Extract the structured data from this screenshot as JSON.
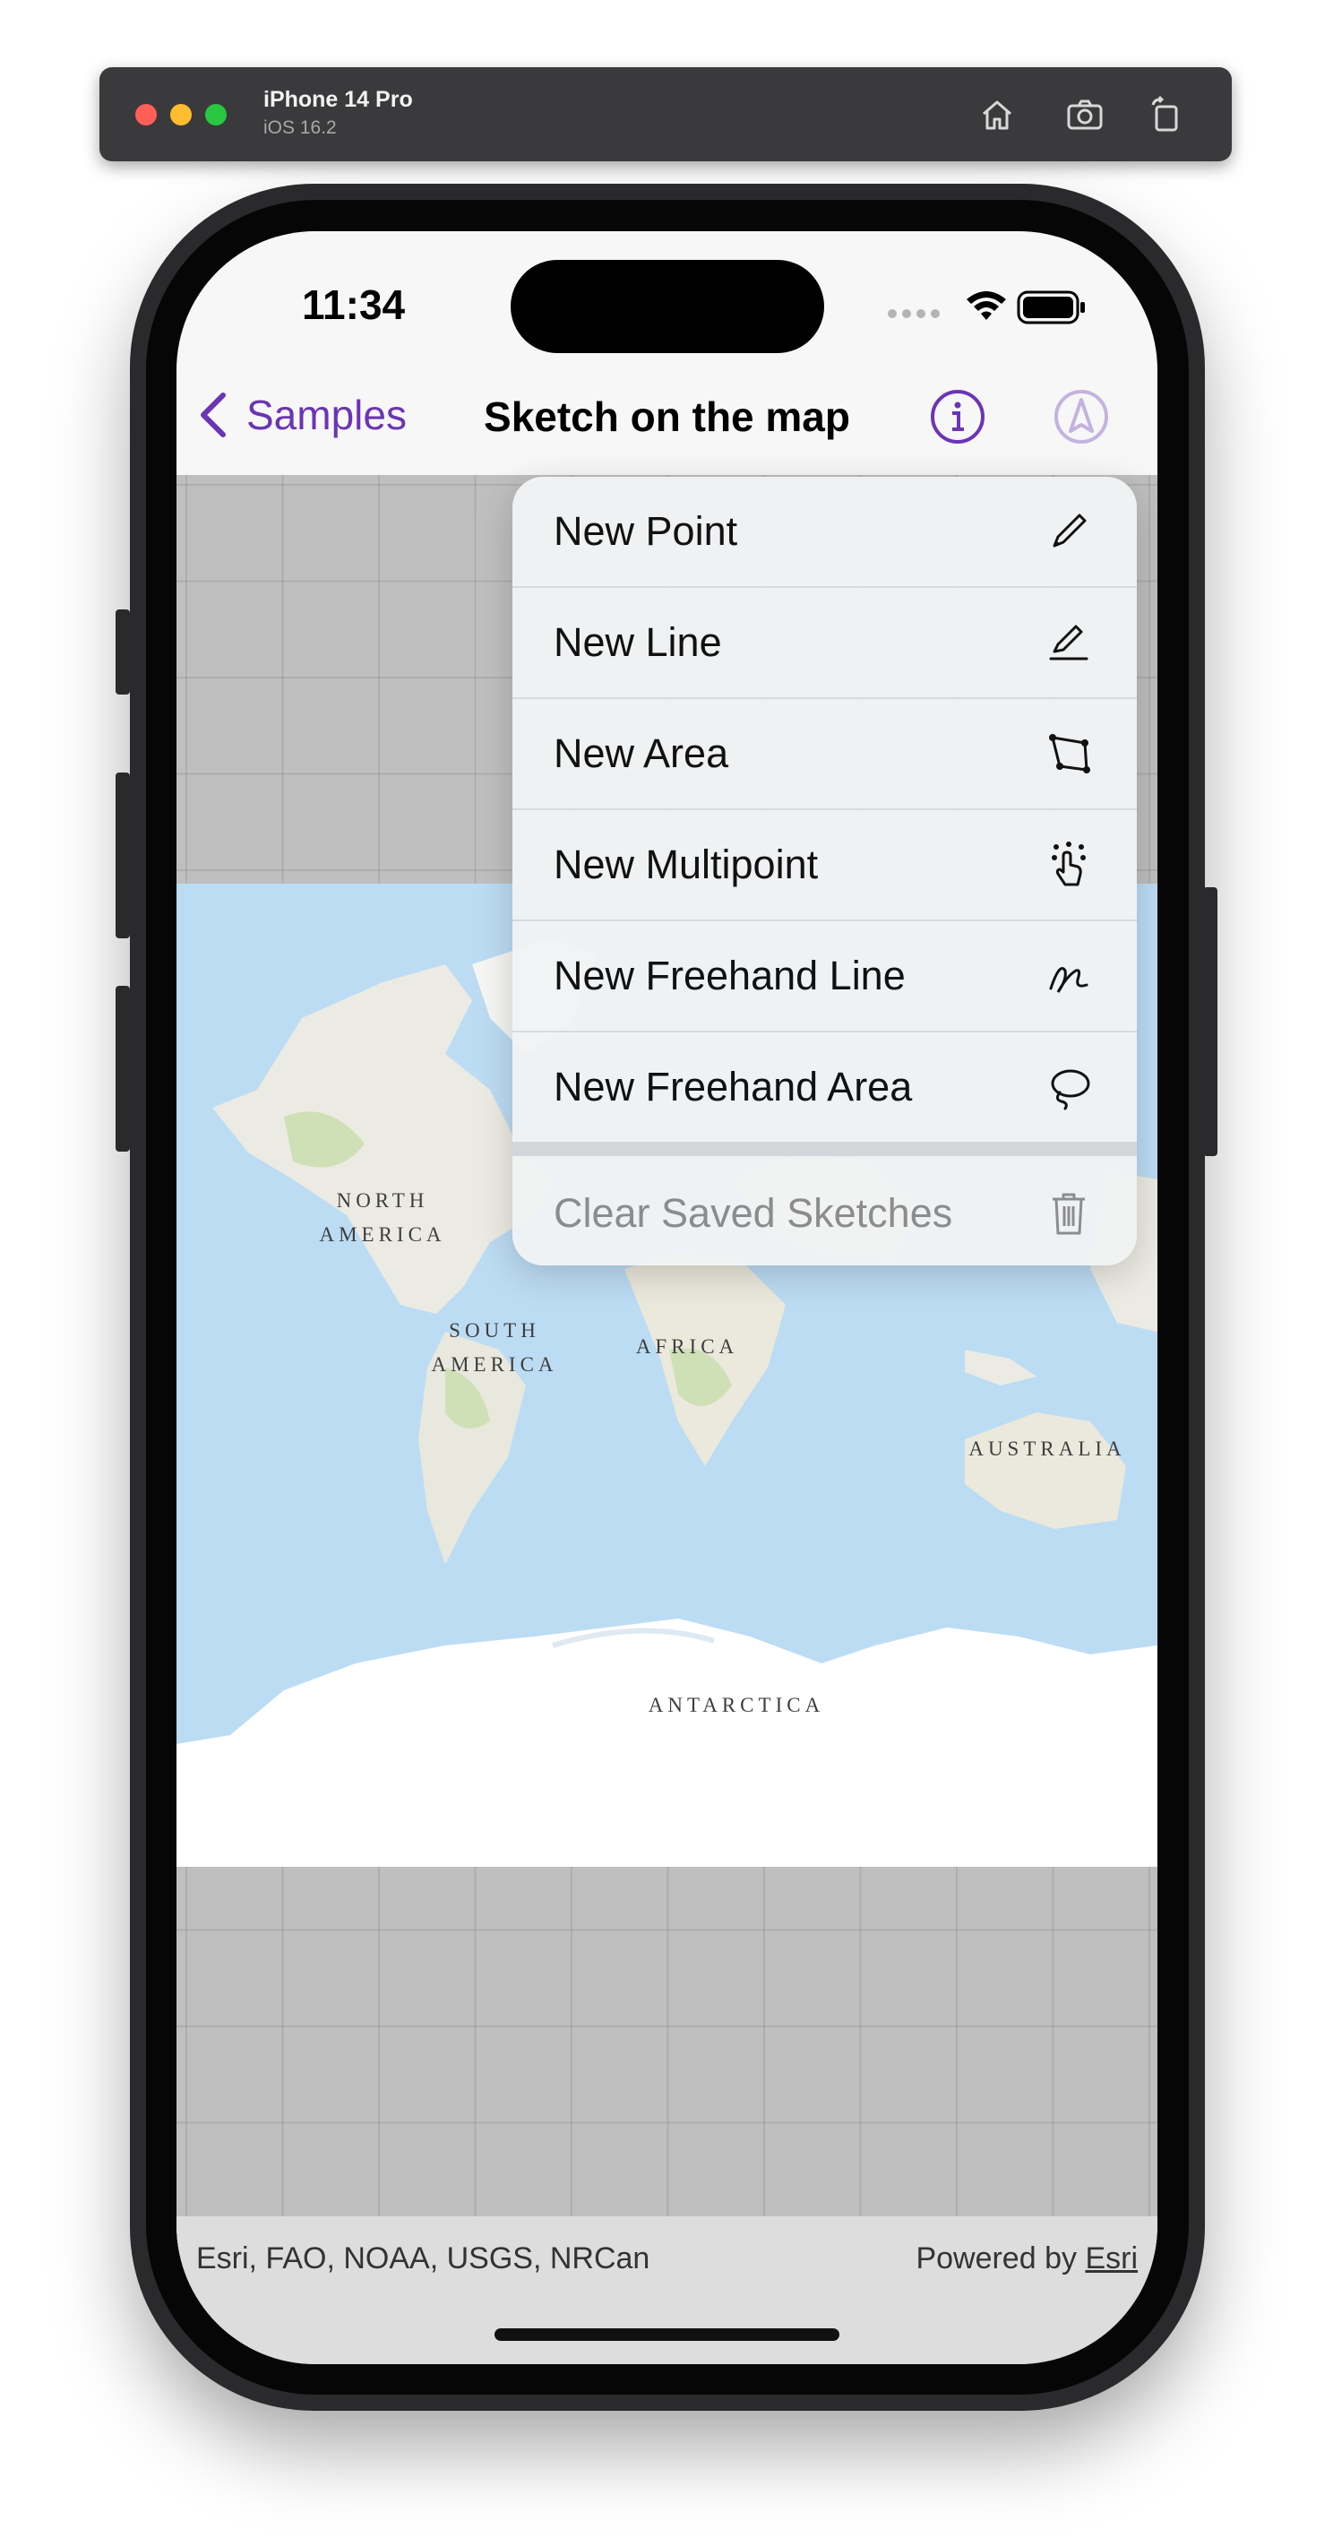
{
  "simulator": {
    "device_name": "iPhone 14 Pro",
    "os_version": "iOS 16.2",
    "buttons": [
      "home-icon",
      "screenshot-icon",
      "rotate-icon"
    ]
  },
  "status_bar": {
    "time": "11:34",
    "icons": [
      "signal-dots-icon",
      "wifi-icon",
      "battery-icon"
    ]
  },
  "nav": {
    "back_label": "Samples",
    "title": "Sketch on the map",
    "right_icons": [
      "info-icon",
      "location-icon"
    ]
  },
  "menu": {
    "items": [
      {
        "label": "New Point",
        "icon": "pencil-icon"
      },
      {
        "label": "New Line",
        "icon": "line-pencil-icon"
      },
      {
        "label": "New Area",
        "icon": "polygon-icon"
      },
      {
        "label": "New Multipoint",
        "icon": "tap-multipoint-icon"
      },
      {
        "label": "New Freehand Line",
        "icon": "freehand-line-icon"
      },
      {
        "label": "New Freehand Area",
        "icon": "lasso-icon"
      }
    ],
    "clear": {
      "label": "Clear Saved Sketches",
      "icon": "trash-icon"
    }
  },
  "map": {
    "labels": {
      "north_america": "NORTH\nAMERICA",
      "south_america": "SOUTH\nAMERICA",
      "africa": "AFRICA",
      "australia": "AUSTRALIA",
      "antarctica": "ANTARCTICA"
    },
    "colors": {
      "ocean": "#bcdcf4",
      "land": "#ecebe3",
      "vegetation": "#cfe0b6",
      "ice": "#ffffff",
      "grid": "#bfbfbf"
    }
  },
  "attribution": {
    "left": "Esri, FAO, NOAA, USGS, NRCan",
    "right_prefix": "Powered by ",
    "right_link": "Esri"
  },
  "colors": {
    "accent": "#6b35b5"
  }
}
